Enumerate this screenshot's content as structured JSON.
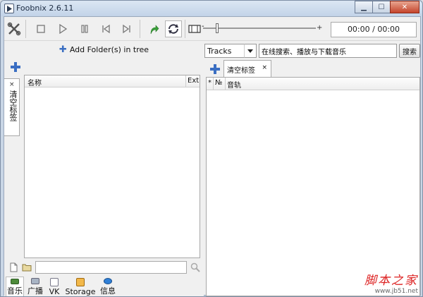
{
  "window": {
    "title": "Foobnix 2.6.11",
    "minimize_symbol": "▁",
    "maximize_symbol": "☐",
    "close_symbol": "✕"
  },
  "toolbar": {
    "time": "00:00 / 00:00",
    "seek_plus": "+",
    "seek_minus": "-"
  },
  "left": {
    "add_folder_label": "Add Folder(s) in tree",
    "vertical_tab_label": "清空标签",
    "vertical_tab_close": "×",
    "tree_columns": {
      "name": "名称",
      "ext": "Ext"
    },
    "search_value": "",
    "nav_tabs": [
      {
        "label": "音乐"
      },
      {
        "label": "广播"
      },
      {
        "label": "VK"
      },
      {
        "label": "Storage"
      },
      {
        "label": "信息"
      }
    ]
  },
  "right": {
    "search_mode": "Tracks",
    "search_query": "在线搜索、播放与下载音乐",
    "search_button": "搜索",
    "tab_label": "清空标签",
    "tab_close": "×",
    "columns": {
      "star": "*",
      "num": "№",
      "track": "音轨"
    }
  },
  "watermark": {
    "main": "脚本之家",
    "sub": "www.jb51.net"
  },
  "colors": {
    "accent_blue": "#3a6ec2",
    "play_green": "#3aa03a",
    "close_red": "#c4442b"
  }
}
